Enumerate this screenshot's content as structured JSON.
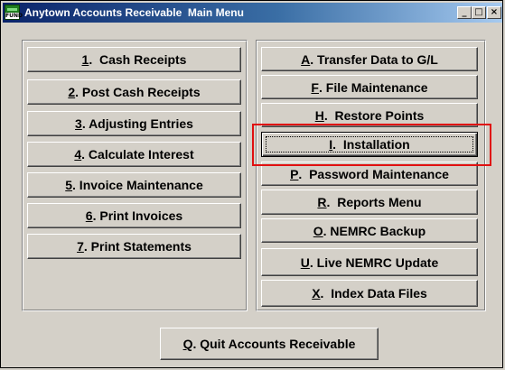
{
  "window": {
    "title": "Anytown Accounts Receivable  Main Menu",
    "icon_label": "FUND",
    "controls": {
      "minimize": "_",
      "maximize": "□",
      "close": "×"
    }
  },
  "left_menu": [
    {
      "key": "1",
      "rest": ".  Cash Receipts"
    },
    {
      "key": "2",
      "rest": ". Post Cash Receipts"
    },
    {
      "key": "3",
      "rest": ". Adjusting Entries"
    },
    {
      "key": "4",
      "rest": ". Calculate Interest"
    },
    {
      "key": "5",
      "rest": ". Invoice Maintenance"
    },
    {
      "key": "6",
      "rest": ". Print Invoices"
    },
    {
      "key": "7",
      "rest": ". Print Statements"
    }
  ],
  "right_menu": [
    {
      "key": "A",
      "rest": ". Transfer Data to G/L"
    },
    {
      "key": "F",
      "rest": ". File Maintenance"
    },
    {
      "key": "H",
      "rest": ".  Restore Points"
    },
    {
      "key": "I",
      "rest": ".  Installation"
    },
    {
      "key": "P",
      "rest": ".  Password Maintenance"
    },
    {
      "key": "R",
      "rest": ".  Reports Menu"
    },
    {
      "key": "O",
      "rest": ". NEMRC Backup"
    },
    {
      "key": "U",
      "rest": ". Live NEMRC Update"
    },
    {
      "key": "X",
      "rest": ".  Index Data Files"
    }
  ],
  "quit_button": {
    "key": "Q",
    "rest": ". Quit Accounts Receivable"
  },
  "colors": {
    "highlight": "#e01010",
    "title_bar_start": "#0a246a",
    "title_bar_end": "#a6caf0",
    "face": "#d4d0c8"
  }
}
